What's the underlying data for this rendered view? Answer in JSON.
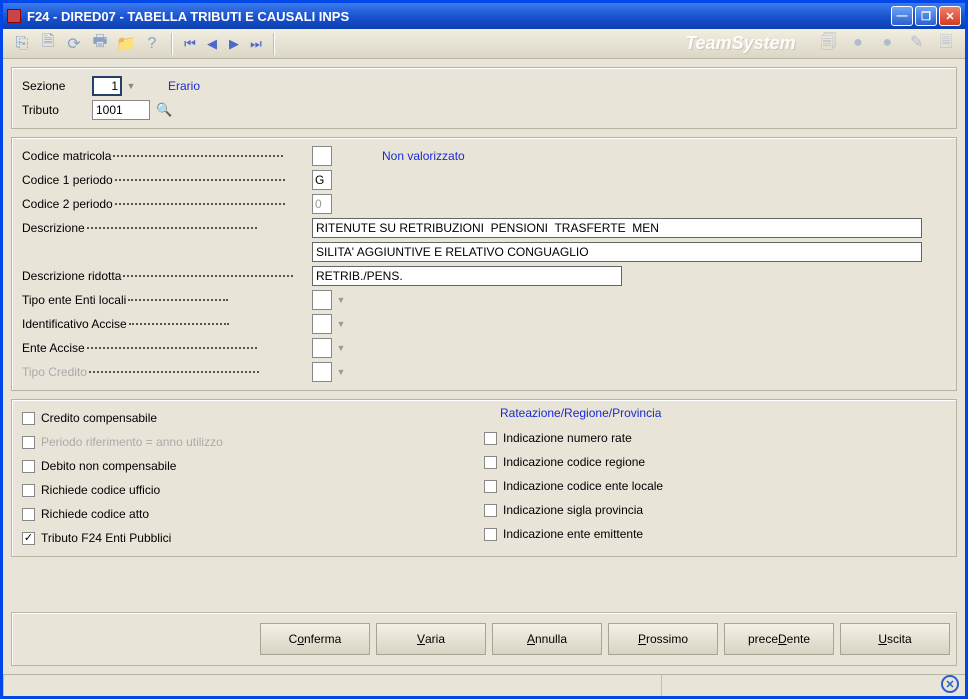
{
  "window": {
    "title": "F24  - DIRED07 -  TABELLA TRIBUTI E CAUSALI INPS"
  },
  "header": {
    "sezione_label": "Sezione",
    "sezione_value": "1",
    "sezione_desc": "Erario",
    "tributo_label": "Tributo",
    "tributo_value": "1001"
  },
  "fields": {
    "codice_matricola_label": "Codice matricola",
    "codice_matricola_value": "",
    "non_valorizzato": "Non valorizzato",
    "codice1_label": "Codice 1 periodo",
    "codice1_value": "G",
    "codice2_label": "Codice 2 periodo",
    "codice2_value": "0",
    "descrizione_label": "Descrizione",
    "descrizione_line1": "RITENUTE SU RETRIBUZIONI  PENSIONI  TRASFERTE  MEN",
    "descrizione_line2": "SILITA' AGGIUNTIVE E RELATIVO CONGUAGLIO",
    "descrizione_ridotta_label": "Descrizione ridotta",
    "descrizione_ridotta_value": "RETRIB./PENS.",
    "tipo_ente_label": "Tipo ente Enti locali",
    "tipo_ente_value": "",
    "id_accise_label": "Identificativo Accise",
    "id_accise_value": "",
    "ente_accise_label": "Ente Accise",
    "ente_accise_value": "",
    "tipo_credito_label": "Tipo Credito",
    "tipo_credito_value": ""
  },
  "checks_left": {
    "credito_comp": "Credito compensabile",
    "periodo_rif": "Periodo riferimento = anno utilizzo",
    "debito_non_comp": "Debito non compensabile",
    "rich_cod_ufficio": "Richiede codice ufficio",
    "rich_cod_atto": "Richiede codice atto",
    "tributo_f24": "Tributo F24 Enti Pubblici"
  },
  "checks_right": {
    "title": "Rateazione/Regione/Provincia",
    "ind_num_rate": "Indicazione numero rate",
    "ind_cod_regione": "Indicazione codice regione",
    "ind_cod_ente_locale": "Indicazione codice ente locale",
    "ind_sigla_prov": "Indicazione sigla provincia",
    "ind_ente_emit": "Indicazione ente emittente"
  },
  "footer": {
    "conferma_pre": "C",
    "conferma_u": "o",
    "conferma_post": "nferma",
    "varia_pre": "",
    "varia_u": "V",
    "varia_post": "aria",
    "annulla_pre": "",
    "annulla_u": "A",
    "annulla_post": "nnulla",
    "prossimo_pre": "",
    "prossimo_u": "P",
    "prossimo_post": "rossimo",
    "precedente_pre": "prece",
    "precedente_u": "D",
    "precedente_post": "ente",
    "uscita_pre": "",
    "uscita_u": "U",
    "uscita_post": "scita"
  },
  "brand": "TeamSystem"
}
